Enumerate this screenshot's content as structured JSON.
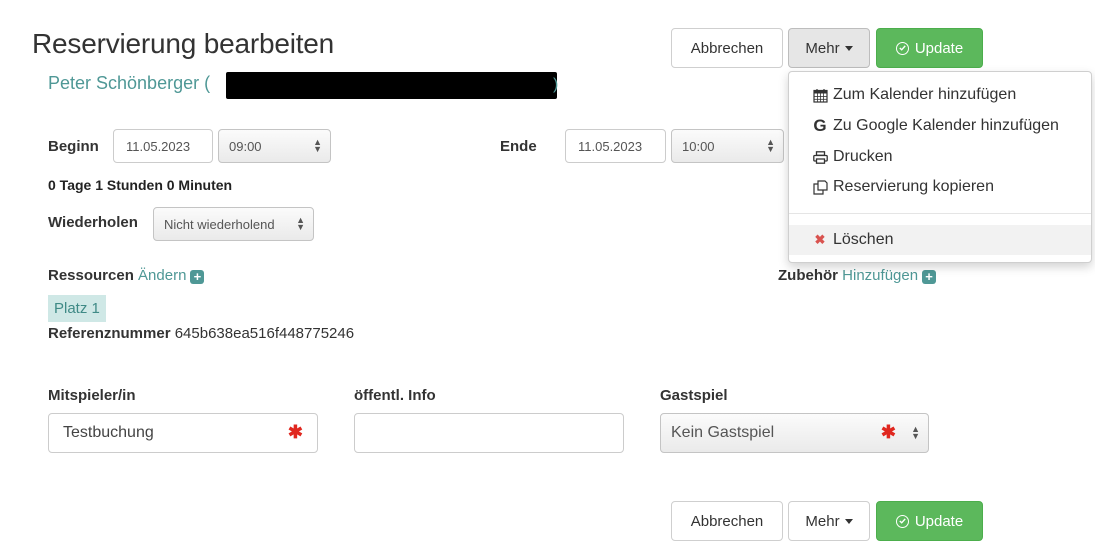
{
  "header": {
    "title": "Reservierung bearbeiten",
    "user_name": "Peter Schönberger (",
    "user_paren_end": ")"
  },
  "toolbar": {
    "cancel_label": "Abbrechen",
    "more_label": "Mehr",
    "update_label": "Update"
  },
  "dropdown": {
    "items": [
      {
        "label": "Zum Kalender hinzufügen",
        "icon": "calendar-icon"
      },
      {
        "label": "Zu Google Kalender hinzufügen",
        "icon": "google-icon"
      },
      {
        "label": "Drucken",
        "icon": "print-icon"
      },
      {
        "label": "Reservierung kopieren",
        "icon": "copy-icon"
      }
    ],
    "delete_label": "Löschen",
    "delete_icon": "delete-icon"
  },
  "times": {
    "begin_label": "Beginn",
    "begin_date": "11.05.2023",
    "begin_time": "09:00",
    "end_label": "Ende",
    "end_date": "11.05.2023",
    "end_time": "10:00",
    "duration": "0 Tage 1 Stunden 0 Minuten"
  },
  "repeat": {
    "label": "Wiederholen",
    "value": "Nicht wiederholend"
  },
  "resources": {
    "label": "Ressourcen",
    "change_link": "Ändern",
    "item": "Platz 1",
    "accessories_label": "Zubehör",
    "add_link": "Hinzufügen"
  },
  "reference": {
    "label": "Referenznummer",
    "value": "645b638ea516f448775246"
  },
  "fields": {
    "player_label": "Mitspieler/in",
    "player_value": "Testbuchung",
    "info_label": "öffentl. Info",
    "info_value": "",
    "guest_label": "Gastspiel",
    "guest_value": "Kein Gastspiel"
  },
  "colors": {
    "accent": "#4f9896",
    "success": "#5cb85c",
    "required": "#e0271f"
  }
}
